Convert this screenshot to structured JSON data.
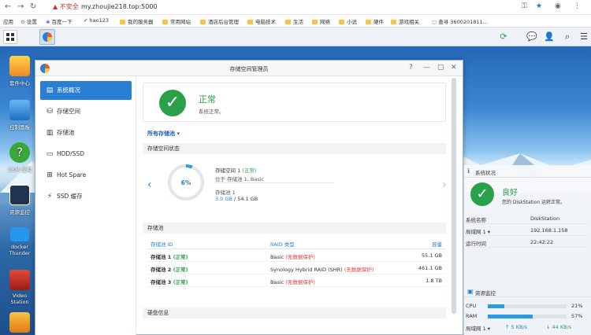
{
  "browser": {
    "security": "不安全",
    "url": "my.zhoujie218.top:5000",
    "bookmarks": [
      "应用",
      "设置",
      "百度一下",
      "hao123",
      "我的服务器",
      "常用网站",
      "酒店后台管理",
      "电脑技术",
      "生活",
      "网络",
      "小说",
      "硬件",
      "游戏相关",
      "查寻 3600201811..."
    ]
  },
  "desktop": {
    "icons": [
      "套件中心",
      "控制面板",
      "DSM 说明",
      "资源监控",
      "docker\nThunder",
      "Video Station"
    ]
  },
  "window": {
    "title": "存储空间管理员",
    "nav": [
      "系统概况",
      "存储空间",
      "存储池",
      "HDD/SSD",
      "Hot Spare",
      "SSD 缓存"
    ],
    "status": {
      "title": "正常",
      "desc": "系统正常。"
    },
    "filter_label": "所有存储池",
    "section_volume": "存储空间状态",
    "volume": {
      "percent": 6,
      "percent_label": "6%",
      "name": "存储空间 1",
      "state": "(正常)",
      "location": "位于 存储池 1, Basic",
      "pool_label": "存储池 1",
      "used": "3.0 GB",
      "total": "54.1 GB"
    },
    "section_pools": "存储池",
    "pool_table": {
      "headers": [
        "存储池 ID",
        "RAID 类型",
        "容量"
      ],
      "rows": [
        {
          "id": "存储池 1",
          "state": "(正常)",
          "raid": "Basic",
          "raid_note": "(无数据保护)",
          "cap": "55.1 GB"
        },
        {
          "id": "存储池 2",
          "state": "(正常)",
          "raid": "Synology Hybrid RAID (SHR)",
          "raid_note": "(无数据保护)",
          "cap": "461.1 GB"
        },
        {
          "id": "存储池 3",
          "state": "(正常)",
          "raid": "Basic",
          "raid_note": "(无数据保护)",
          "cap": "1.8 TB"
        }
      ]
    },
    "section_disk": "硬盘信息"
  },
  "health": {
    "title": "系统状况",
    "status": "良好",
    "desc": "您的 DiskStation 运转正常。",
    "rows": [
      {
        "k": "系统名称",
        "v": "DiskStation"
      },
      {
        "k": "局域网 1 ▾",
        "v": "192.168.1.158"
      },
      {
        "k": "运行时间",
        "v": "22:42:22"
      }
    ]
  },
  "monitor": {
    "title": "资源监控",
    "cpu_label": "CPU",
    "cpu": 21,
    "cpu_text": "21%",
    "ram_label": "RAM",
    "ram": 57,
    "ram_text": "57%",
    "lan_label": "局域网 1 ▾",
    "up": "5 KB/s",
    "down": "44 KB/s"
  },
  "colors": {
    "accent": "#2a7fd4",
    "ok": "#2aa148",
    "warn": "#e03b3b"
  }
}
